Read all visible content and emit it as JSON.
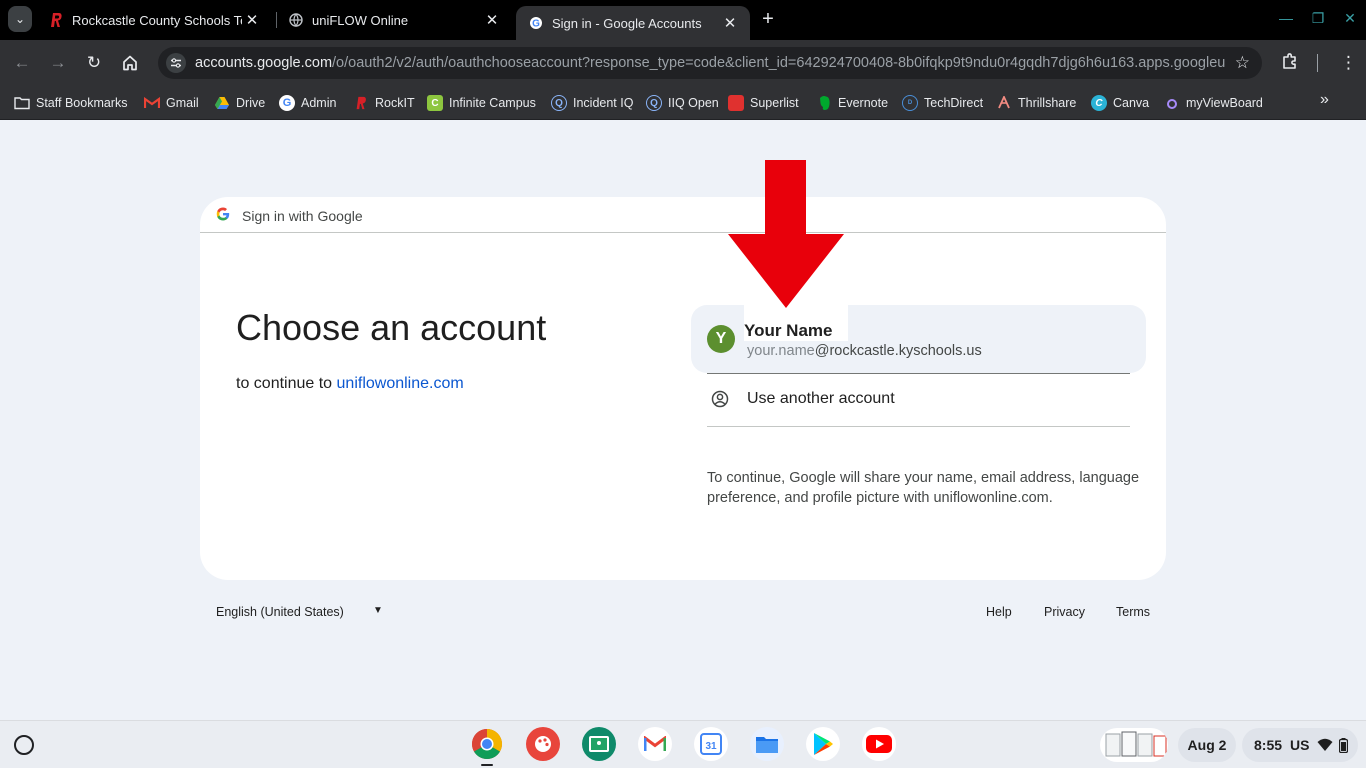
{
  "tabs": [
    {
      "title": "Rockcastle County Schools Tec",
      "active": false
    },
    {
      "title": "uniFLOW Online",
      "active": false
    },
    {
      "title": "Sign in - Google Accounts",
      "active": true
    }
  ],
  "address_bar": {
    "host": "accounts.google.com",
    "path": "/o/oauth2/v2/auth/oauthchooseaccount?response_type=code&client_id=642924700408-8b0ifqkp9t9ndu0r4gqdh7djg6h6u163.apps.googleu…"
  },
  "bookmarks": [
    {
      "label": "Staff Bookmarks",
      "icon": "folder-icon"
    },
    {
      "label": "Gmail",
      "icon": "gmail-icon"
    },
    {
      "label": "Drive",
      "icon": "drive-icon"
    },
    {
      "label": "Admin",
      "icon": "google-icon"
    },
    {
      "label": "RockIT",
      "icon": "rockit-icon"
    },
    {
      "label": "Infinite Campus",
      "icon": "infinite-campus-icon"
    },
    {
      "label": "Incident IQ",
      "icon": "incident-iq-icon"
    },
    {
      "label": "IIQ Open",
      "icon": "iiq-open-icon"
    },
    {
      "label": "Superlist",
      "icon": "superlist-icon"
    },
    {
      "label": "Evernote",
      "icon": "evernote-icon"
    },
    {
      "label": "TechDirect",
      "icon": "dell-icon"
    },
    {
      "label": "Thrillshare",
      "icon": "thrillshare-icon"
    },
    {
      "label": "Canva",
      "icon": "canva-icon"
    },
    {
      "label": "myViewBoard",
      "icon": "myviewboard-icon"
    }
  ],
  "signin": {
    "header": "Sign in with Google",
    "title": "Choose an account",
    "subtitle_prefix": "to continue to ",
    "subtitle_link": "uniflowonline.com",
    "account": {
      "initial": "Y",
      "name": "Your Name",
      "email_user": "your.name",
      "email_domain": "@rockcastle.kyschools.us"
    },
    "use_another": "Use another account",
    "notice": "To continue, Google will share your name, email address, language preference, and profile picture with uniflowonline.com."
  },
  "footer": {
    "language": "English (United States)",
    "links": [
      "Help",
      "Privacy",
      "Terms"
    ]
  },
  "shelf": {
    "apps": [
      "chrome-icon",
      "canvas-icon",
      "classroom-icon",
      "gmail-icon",
      "calendar-icon",
      "files-icon",
      "play-store-icon",
      "youtube-icon"
    ],
    "calendar_day": "31",
    "date": "Aug 2",
    "time": "8:55",
    "locale": "US"
  },
  "colors": {
    "link": "#0b57d0",
    "avatar": "#5c8f2f",
    "arrow": "#e8000b",
    "page_bg": "#eef2f8"
  }
}
